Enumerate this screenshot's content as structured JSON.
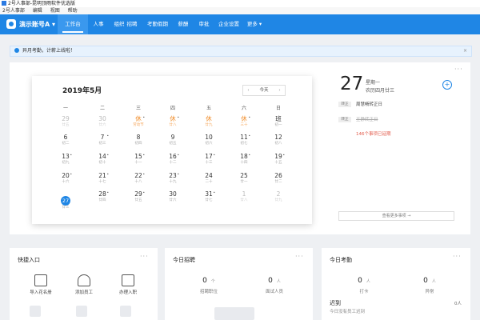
{
  "window": {
    "title": "2号人事部-昆明顶雨软件优选版"
  },
  "menubar": {
    "items": [
      "2号人事部",
      "编辑",
      "视图",
      "帮助"
    ]
  },
  "nav": {
    "account": "演示账号A ▾",
    "tabs": [
      "工作台",
      "人事",
      "组织",
      "招聘",
      "考勤假期",
      "薪酬",
      "审批",
      "企业设置",
      "更多 ▾"
    ]
  },
  "notice": {
    "text": "异月考勤，计薪上线啦！",
    "close": "×"
  },
  "calendar": {
    "title": "2019年5月",
    "today_button": "今天",
    "prev": "‹",
    "next": "›",
    "weekdays": [
      "一",
      "二",
      "三",
      "四",
      "五",
      "六",
      "日"
    ],
    "rows": [
      [
        {
          "n": "29",
          "s": "廿五",
          "type": "dim"
        },
        {
          "n": "30",
          "s": "廿六",
          "type": "dim"
        },
        {
          "n": "休",
          "s": "劳动节",
          "type": "rest",
          "sup": "•"
        },
        {
          "n": "休",
          "s": "廿八",
          "type": "rest",
          "sup": "•"
        },
        {
          "n": "休",
          "s": "廿九",
          "type": "rest"
        },
        {
          "n": "休",
          "s": "三十",
          "type": "rest",
          "sup": "•"
        },
        {
          "n": "班",
          "s": "初一",
          "type": "work"
        }
      ],
      [
        {
          "n": "6",
          "s": "初二"
        },
        {
          "n": "7",
          "s": "初三",
          "sup": "•"
        },
        {
          "n": "8",
          "s": "初四"
        },
        {
          "n": "9",
          "s": "初五"
        },
        {
          "n": "10",
          "s": "初六"
        },
        {
          "n": "11",
          "s": "初七",
          "sup": "•"
        },
        {
          "n": "12",
          "s": "初八"
        }
      ],
      [
        {
          "n": "13",
          "s": "初九",
          "sup": "•"
        },
        {
          "n": "14",
          "s": "初十",
          "sup": "•"
        },
        {
          "n": "15",
          "s": "十一",
          "sup": "•"
        },
        {
          "n": "16",
          "s": "十二",
          "sup": "•"
        },
        {
          "n": "17",
          "s": "十三",
          "sup": "•"
        },
        {
          "n": "18",
          "s": "十四",
          "sup": "•"
        },
        {
          "n": "19",
          "s": "十五",
          "sup": "•"
        }
      ],
      [
        {
          "n": "20",
          "s": "十六",
          "sup": "•"
        },
        {
          "n": "21",
          "s": "十七",
          "sup": "•"
        },
        {
          "n": "22",
          "s": "十八",
          "sup": "•"
        },
        {
          "n": "23",
          "s": "十九",
          "sup": "•"
        },
        {
          "n": "24",
          "s": "二十"
        },
        {
          "n": "25",
          "s": "廿一"
        },
        {
          "n": "26",
          "s": "廿二"
        }
      ],
      [
        {
          "n": "27",
          "s": "廿三",
          "type": "today"
        },
        {
          "n": "28",
          "s": "廿四",
          "sup": "•"
        },
        {
          "n": "29",
          "s": "廿五",
          "sup": "•"
        },
        {
          "n": "30",
          "s": "廿六"
        },
        {
          "n": "31",
          "s": "廿七",
          "sup": "•"
        },
        {
          "n": "1",
          "s": "廿八",
          "type": "dim"
        },
        {
          "n": "2",
          "s": "廿九",
          "type": "dim"
        }
      ]
    ]
  },
  "today_panel": {
    "date": "27",
    "weekday": "星期一",
    "lunar": "农历四月廿三",
    "events": [
      {
        "badge": "转正",
        "text": "周慧畅转正日",
        "style": "normal"
      },
      {
        "badge": "转正",
        "text": "王静转正日",
        "style": "strike"
      },
      {
        "badge": "",
        "text": "146个事项已延期",
        "style": "red"
      }
    ],
    "more_button": "查看更多事项 →",
    "add": "+",
    "dots": "···"
  },
  "quick_entry": {
    "title": "快捷入口",
    "items": [
      "导入花名册",
      "添加员工",
      "办理入职"
    ]
  },
  "recruit_today": {
    "title": "今日招聘",
    "stats": [
      {
        "value": "0",
        "unit": "个",
        "label": "招聘职位"
      },
      {
        "value": "0",
        "unit": "人",
        "label": "面试人员"
      }
    ]
  },
  "attendance_today": {
    "title": "今日考勤",
    "stats": [
      {
        "value": "0",
        "unit": "人",
        "label": "打卡"
      },
      {
        "value": "0",
        "unit": "人",
        "label": "异常"
      }
    ],
    "late_title": "迟到",
    "late_count": "0人",
    "late_desc": "今日没有员工迟到"
  },
  "colors": {
    "brand": "#1f86e5",
    "rest": "#f08a24",
    "alert": "#e25b4b"
  }
}
